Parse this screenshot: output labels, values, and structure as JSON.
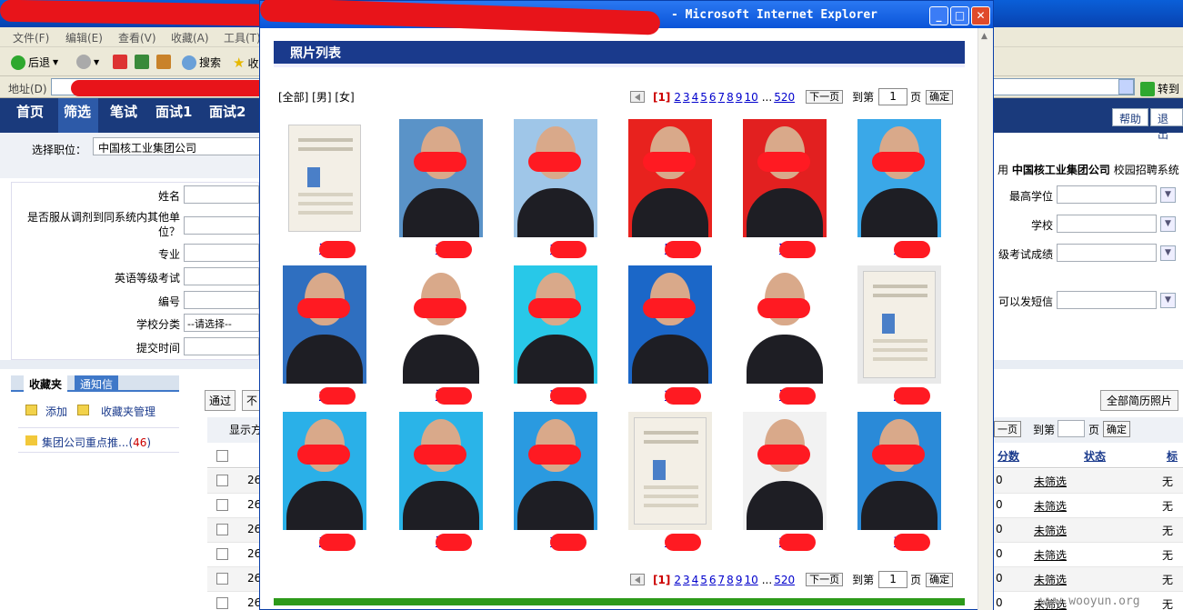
{
  "background": {
    "menu": [
      "文件(F)",
      "编辑(E)",
      "查看(V)",
      "收藏(A)",
      "工具(T)"
    ],
    "toolbar": {
      "back": "后退",
      "search": "搜索",
      "favorites": "收"
    },
    "address_label": "地址(D)",
    "go_label": "转到",
    "nav": [
      "首页",
      "筛选",
      "笔试",
      "面试1",
      "面试2"
    ],
    "nav_right": [
      "帮助",
      "退出"
    ],
    "position_label": "选择职位：",
    "position_value": "中国核工业集团公司",
    "right_header": {
      "prefix": "用",
      "company": "中国核工业集团公司",
      "suffix": "校园招聘系统"
    },
    "form_labels": [
      "姓名",
      "是否服从调剂到同系统内其他单位？",
      "专业",
      "英语等级考试",
      "编号",
      "学校分类",
      "提交时间"
    ],
    "school_category": "--请选择--",
    "right_labels": [
      "最高学位",
      "学校",
      "级考试成绩",
      "可以发短信"
    ],
    "tabs": [
      "收藏夹",
      "通知信"
    ],
    "fav_add": "添加",
    "fav_manage": "收藏夹管理",
    "fav_folder": {
      "name": "集团公司重点推...",
      "count": "46"
    },
    "action_pass": "通过",
    "action_other": "不",
    "show_label": "显示方",
    "all_photos_button": "全部简历照片",
    "bg_pager": {
      "next": "一页",
      "goto": "到第",
      "page": "页",
      "ok": "确定"
    },
    "table_headers": [
      "分数",
      "状态",
      "标"
    ],
    "table_rows": [
      {
        "id": "26",
        "score": "0",
        "status": "未筛选",
        "mark": "无"
      },
      {
        "id": "26",
        "score": "0",
        "status": "未筛选",
        "mark": "无"
      },
      {
        "id": "26",
        "score": "0",
        "status": "未筛选",
        "mark": "无"
      },
      {
        "id": "26",
        "score": "0",
        "status": "未筛选",
        "mark": "无"
      },
      {
        "id": "26",
        "score": "0",
        "status": "未筛选",
        "mark": "无"
      },
      {
        "id": "26",
        "score": "0",
        "status": "未筛选",
        "mark": "无"
      }
    ]
  },
  "modal": {
    "title_suffix": "- Microsoft Internet Explorer",
    "header": "照片列表",
    "filters": "[全部] [男] [女]",
    "pager": {
      "current": "[1]",
      "pages": [
        "2",
        "3",
        "4",
        "5",
        "6",
        "7",
        "8",
        "9",
        "10",
        "...",
        "520"
      ],
      "next": "下一页",
      "goto": "到第",
      "page_value": "1",
      "page": "页",
      "ok": "确定"
    },
    "photos": [
      {
        "name": "张",
        "bg": "#ffffff",
        "type": "cert",
        "nc": 340
      },
      {
        "name": "李",
        "bg": "#5a93c8",
        "type": "person",
        "nc": 464
      },
      {
        "name": "叶",
        "bg": "#9fc6e8",
        "type": "person",
        "nc": 590
      },
      {
        "name": "陈",
        "bg": "#e8221e",
        "type": "person",
        "nc": 714
      },
      {
        "name": "耿",
        "bg": "#e22020",
        "type": "person",
        "nc": 842
      },
      {
        "name": "白",
        "bg": "#3aa8e8",
        "type": "person",
        "nc": 967
      },
      {
        "name": "方",
        "bg": "#2f6fc0",
        "type": "person",
        "nc": 340
      },
      {
        "name": "汪",
        "bg": "#ffffff",
        "type": "person",
        "nc": 464
      },
      {
        "name": "孙",
        "bg": "#28c8e8",
        "type": "person",
        "nc": 590
      },
      {
        "name": "芮",
        "bg": "#1b67c8",
        "type": "person",
        "nc": 714
      },
      {
        "name": "张",
        "bg": "#ffffff",
        "type": "person",
        "nc": 842
      },
      {
        "name": "史",
        "bg": "#e9e9e9",
        "type": "cert",
        "nc": 967
      },
      {
        "name": "赵",
        "bg": "#2ab0e8",
        "type": "person",
        "nc": 340
      },
      {
        "name": "张",
        "bg": "#2ab4e8",
        "type": "person",
        "nc": 464
      },
      {
        "name": "李",
        "bg": "#2a9ae0",
        "type": "person",
        "nc": 590
      },
      {
        "name": "任",
        "bg": "#f0ece2",
        "type": "cert",
        "nc": 714
      },
      {
        "name": "刘",
        "bg": "#f2f2f2",
        "type": "person",
        "nc": 842
      },
      {
        "name": "曹",
        "bg": "#2a8ad8",
        "type": "person",
        "nc": 967
      }
    ]
  },
  "watermark": "www.wooyun.org"
}
